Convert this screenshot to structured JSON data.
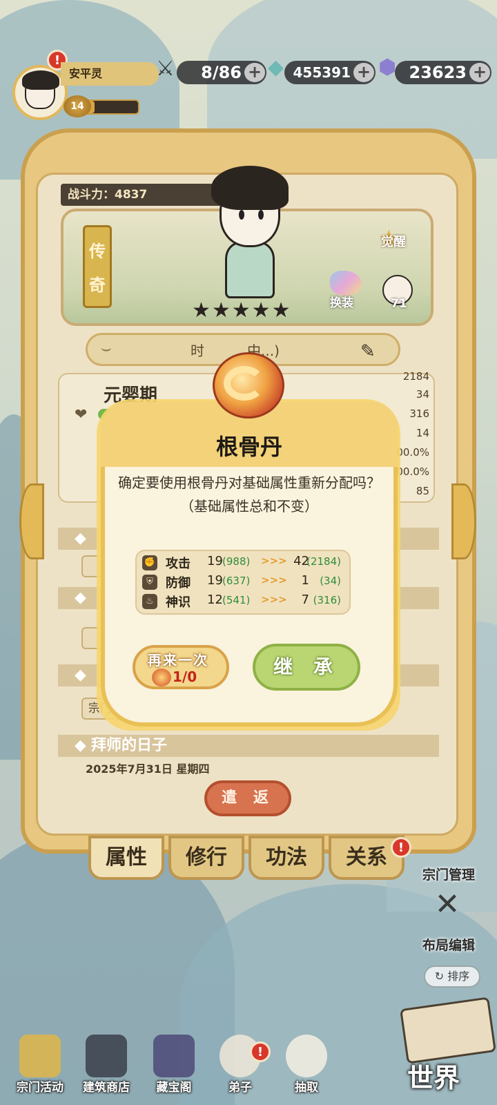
{
  "player": {
    "name": "安平灵",
    "level": "14",
    "exp_fraction": 0.38
  },
  "resources": {
    "stamina": "8/86",
    "crystal": "455391",
    "gem": "23623"
  },
  "disciple": {
    "power_label": "战斗力：4837",
    "rank": [
      "传",
      "奇"
    ],
    "stars": "★★★★★",
    "awaken_label": "觉醒",
    "outfit_label": "换装",
    "avatar_count": "71",
    "title_text": "时",
    "title_text_tail": "中...)",
    "stage": "元婴期",
    "stat_values": [
      "2184",
      "34",
      "316",
      "14",
      "00.0%",
      "00.0%",
      "85"
    ]
  },
  "sections": {
    "s4_chip": "宗门三",
    "s5_title": "拜师的日子",
    "s5_date": "2025年7月31日 星期四"
  },
  "dismiss_label": "遣 返",
  "tabs": [
    "属性",
    "修行",
    "功法",
    "关系"
  ],
  "modal": {
    "title": "根骨丹",
    "message": "确定要使用根骨丹对基础属性重新分配吗？（基础属性总和不变）",
    "rows": [
      {
        "label": "攻击",
        "before": "19",
        "before_total": "(988)",
        "after": "42",
        "after_total": "(2184)"
      },
      {
        "label": "防御",
        "before": "19",
        "before_total": "(637)",
        "after": "1",
        "after_total": "(34)"
      },
      {
        "label": "神识",
        "before": "12",
        "before_total": "(541)",
        "after": "7",
        "after_total": "(316)"
      }
    ],
    "arrow": ">>>",
    "again_label": "再来一次",
    "again_count": "1/0",
    "inherit_label": "继 承"
  },
  "side": {
    "sect_manage": "宗门管理",
    "layout_edit": "布局编辑",
    "sort": "排序"
  },
  "bottom_nav": [
    "宗门活动",
    "建筑商店",
    "藏宝阁",
    "弟子",
    "抽取"
  ],
  "world_label": "世界",
  "colors": {
    "panel": "#e8c780",
    "modal_border": "#e9c055",
    "inherit_button": "#b9d672",
    "dismiss_button": "#d7734e",
    "alert": "#d8372a",
    "gain_green": "#2f8c3c"
  },
  "icons": [
    "sword-icon",
    "crystal-icon",
    "gem-icon",
    "plus-icon",
    "pill-icon",
    "heart-icon",
    "brush-icon",
    "fist-icon",
    "shield-icon",
    "spirit-icon",
    "layout-icon",
    "sort-icon"
  ]
}
